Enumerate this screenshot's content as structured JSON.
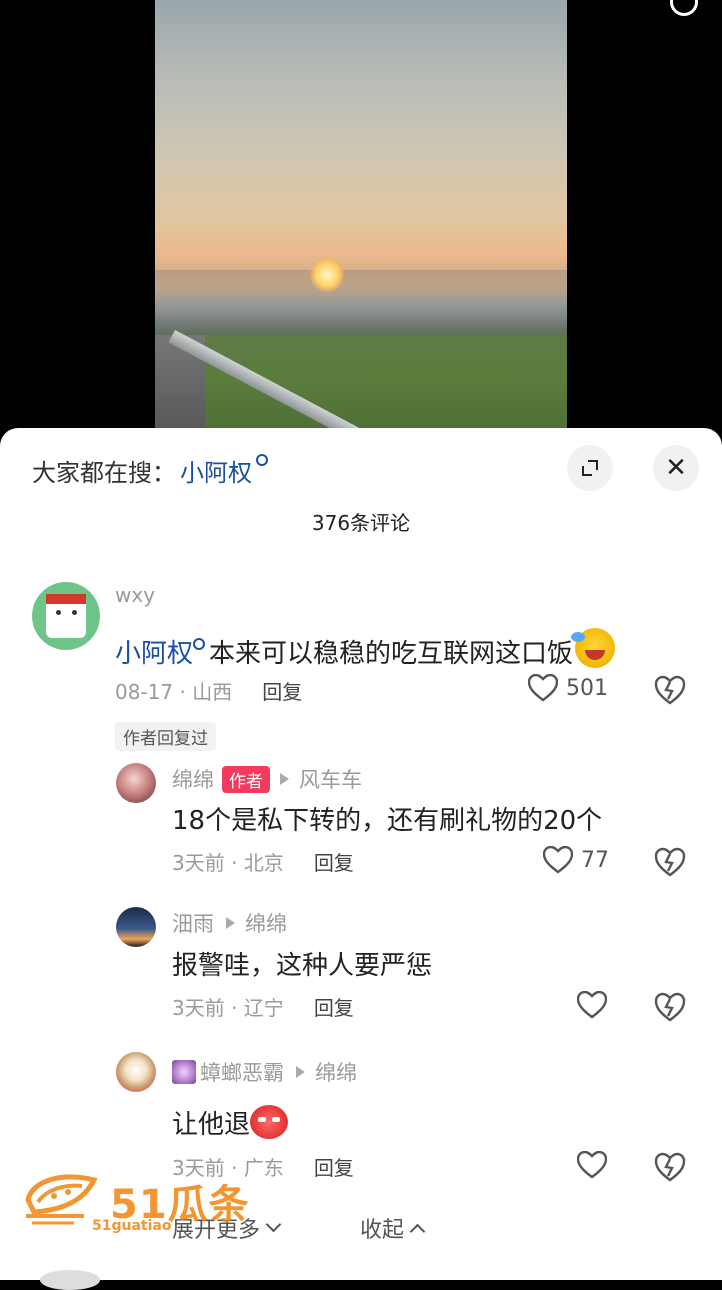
{
  "hot_search": {
    "label": "大家都在搜：",
    "term": "小阿权"
  },
  "comment_count": "376条评论",
  "comments": [
    {
      "user": "wxy",
      "mention": "小阿权",
      "text": "本来可以稳稳的吃互联网这口饭",
      "date": "08-17",
      "location": "山西",
      "reply_label": "回复",
      "likes": "501",
      "author_replied_tag": "作者回复过"
    }
  ],
  "replies": [
    {
      "user": "绵绵",
      "badge": "作者",
      "reply_to": "风车车",
      "text": "18个是私下转的，还有刷礼物的20个",
      "date": "3天前",
      "location": "北京",
      "reply_label": "回复",
      "likes": "77"
    },
    {
      "user": "沺雨",
      "reply_to": "绵绵",
      "text": "报警哇，这种人要严惩",
      "date": "3天前",
      "location": "辽宁",
      "reply_label": "回复",
      "likes": ""
    },
    {
      "user": "蟑螂恶霸",
      "reply_to": "绵绵",
      "text": "让他退",
      "date": "3天前",
      "location": "广东",
      "reply_label": "回复",
      "likes": ""
    }
  ],
  "expand_more": "展开更多",
  "collapse": "收起",
  "watermark": {
    "main": "51瓜条",
    "sub": "51guatiao"
  },
  "icons": [
    "search-icon",
    "expand-icon",
    "close-icon",
    "heart-icon",
    "dislike-icon",
    "chevron-down-icon",
    "chevron-up-icon"
  ]
}
